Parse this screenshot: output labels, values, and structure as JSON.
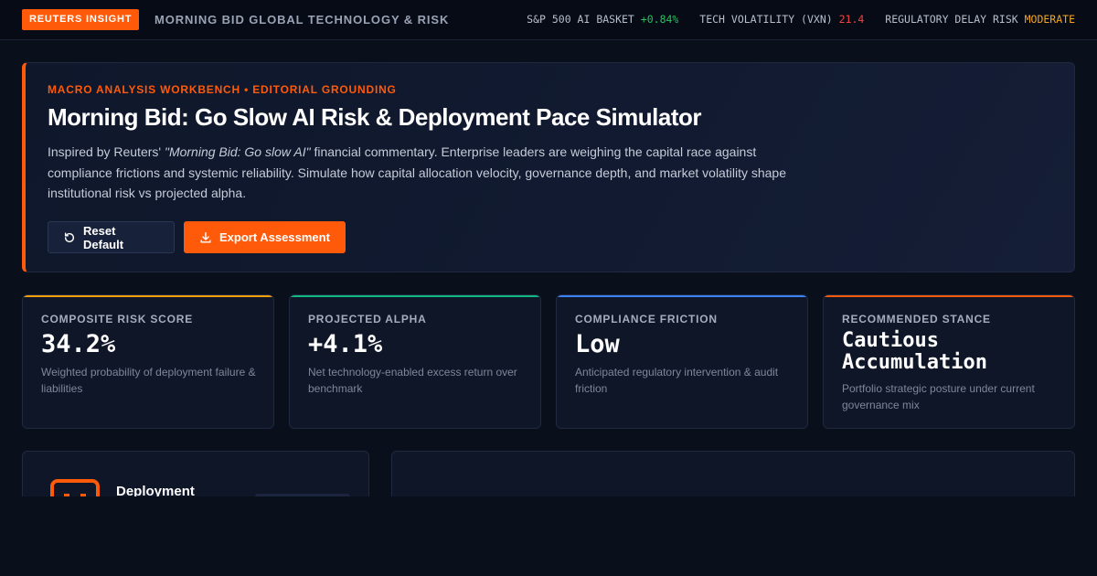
{
  "header": {
    "badge": "REUTERS INSIGHT",
    "title": "MORNING BID GLOBAL TECHNOLOGY & RISK",
    "ticker": [
      {
        "label": "S&P 500 AI BASKET",
        "value": "+0.84%",
        "status": "up"
      },
      {
        "label": "TECH VOLATILITY (VXN)",
        "value": "21.4",
        "status": "down"
      },
      {
        "label": "REGULATORY DELAY RISK",
        "value": "MODERATE",
        "status": "warn"
      }
    ]
  },
  "hero": {
    "eyebrow": "MACRO ANALYSIS WORKBENCH • EDITORIAL GROUNDING",
    "title": "Morning Bid: Go Slow AI Risk & Deployment Pace Simulator",
    "desc_prefix": "Inspired by Reuters' ",
    "desc_quote": "\"Morning Bid: Go slow AI\"",
    "desc_suffix": " financial commentary. Enterprise leaders are weighing the capital race against compliance frictions and systemic reliability. Simulate how capital allocation velocity, governance depth, and market volatility shape institutional risk vs projected alpha.",
    "reset_label": "Reset Default",
    "export_label": "Export Assessment"
  },
  "metrics": [
    {
      "label": "COMPOSITE RISK SCORE",
      "value": "34.2%",
      "desc": "Weighted probability of deployment failure & liabilities",
      "accent": "#f59e0b"
    },
    {
      "label": "PROJECTED ALPHA",
      "value": "+4.1%",
      "desc": "Net technology-enabled excess return over benchmark",
      "accent": "#10b981"
    },
    {
      "label": "COMPLIANCE FRICTION",
      "value": "Low",
      "desc": "Anticipated regulatory intervention & audit friction",
      "accent": "#3b82f6"
    },
    {
      "label": "RECOMMENDED STANCE",
      "value": "Cautious Accumulation",
      "desc": "Portfolio strategic posture under current governance mix",
      "accent": "#ff5a0a"
    }
  ],
  "panels": {
    "left_title": "Deployment"
  },
  "colors": {
    "brand": "#ff5a0a",
    "background": "#0a0f1c",
    "up": "#22c55e",
    "down": "#ef4444",
    "warn": "#f5a524"
  }
}
